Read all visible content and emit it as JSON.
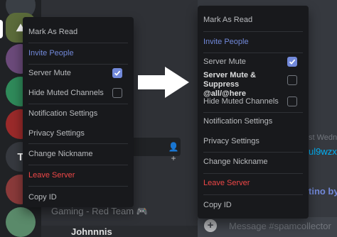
{
  "colors": {
    "accent": "#7289da",
    "danger": "#f04747",
    "menu_bg": "#18191c",
    "chat_bg": "#36393f",
    "sidebar_bg": "#2f3136",
    "rail_bg": "#202225"
  },
  "rail": {
    "servers": [
      {
        "icon": "server-avatar-icon",
        "glyph": "",
        "color": "#3a3f45"
      },
      {
        "icon": "server-avatar-icon",
        "glyph": "",
        "color": "#5b6b3a"
      },
      {
        "icon": "server-avatar-icon",
        "glyph": "",
        "color": "#6b4a7a"
      },
      {
        "icon": "server-avatar-icon",
        "glyph": "",
        "color": "#2f8a5a"
      },
      {
        "icon": "server-avatar-icon",
        "glyph": "",
        "color": "#9a2a2a"
      },
      {
        "icon": "server-avatar-icon",
        "glyph": "T",
        "color": "#36393f"
      },
      {
        "icon": "server-avatar-icon",
        "glyph": "",
        "color": "#8a3a3a"
      },
      {
        "icon": "server-avatar-icon",
        "glyph": "",
        "color": "#5a8a6a"
      }
    ]
  },
  "sidebar": {
    "voice_channel": "Gaming - Red Team 🎮",
    "user_name": "Johnnnis"
  },
  "chat": {
    "fragment_1": "st Wedne",
    "fragment_2": "ul9wzx",
    "fragment_3": "tino by",
    "input_placeholder": "Message #spamcollector"
  },
  "menu_left": {
    "items": [
      {
        "label": "Mark As Read"
      },
      {
        "label": "Invite People"
      },
      {
        "label": "Server Mute",
        "checked": true
      },
      {
        "label": "Hide Muted Channels",
        "checked": false
      },
      {
        "label": "Notification Settings"
      },
      {
        "label": "Privacy Settings"
      },
      {
        "label": "Change Nickname"
      },
      {
        "label": "Leave Server"
      },
      {
        "label": "Copy ID"
      }
    ]
  },
  "menu_right": {
    "items": [
      {
        "label": "Mark As Read"
      },
      {
        "label": "Invite People"
      },
      {
        "label": "Server Mute",
        "checked": true
      },
      {
        "label": "Server Mute & Suppress @all/@here",
        "checked": false
      },
      {
        "label": "Hide Muted Channels",
        "checked": false
      },
      {
        "label": "Notification Settings"
      },
      {
        "label": "Privacy Settings"
      },
      {
        "label": "Change Nickname"
      },
      {
        "label": "Leave Server"
      },
      {
        "label": "Copy ID"
      }
    ]
  }
}
